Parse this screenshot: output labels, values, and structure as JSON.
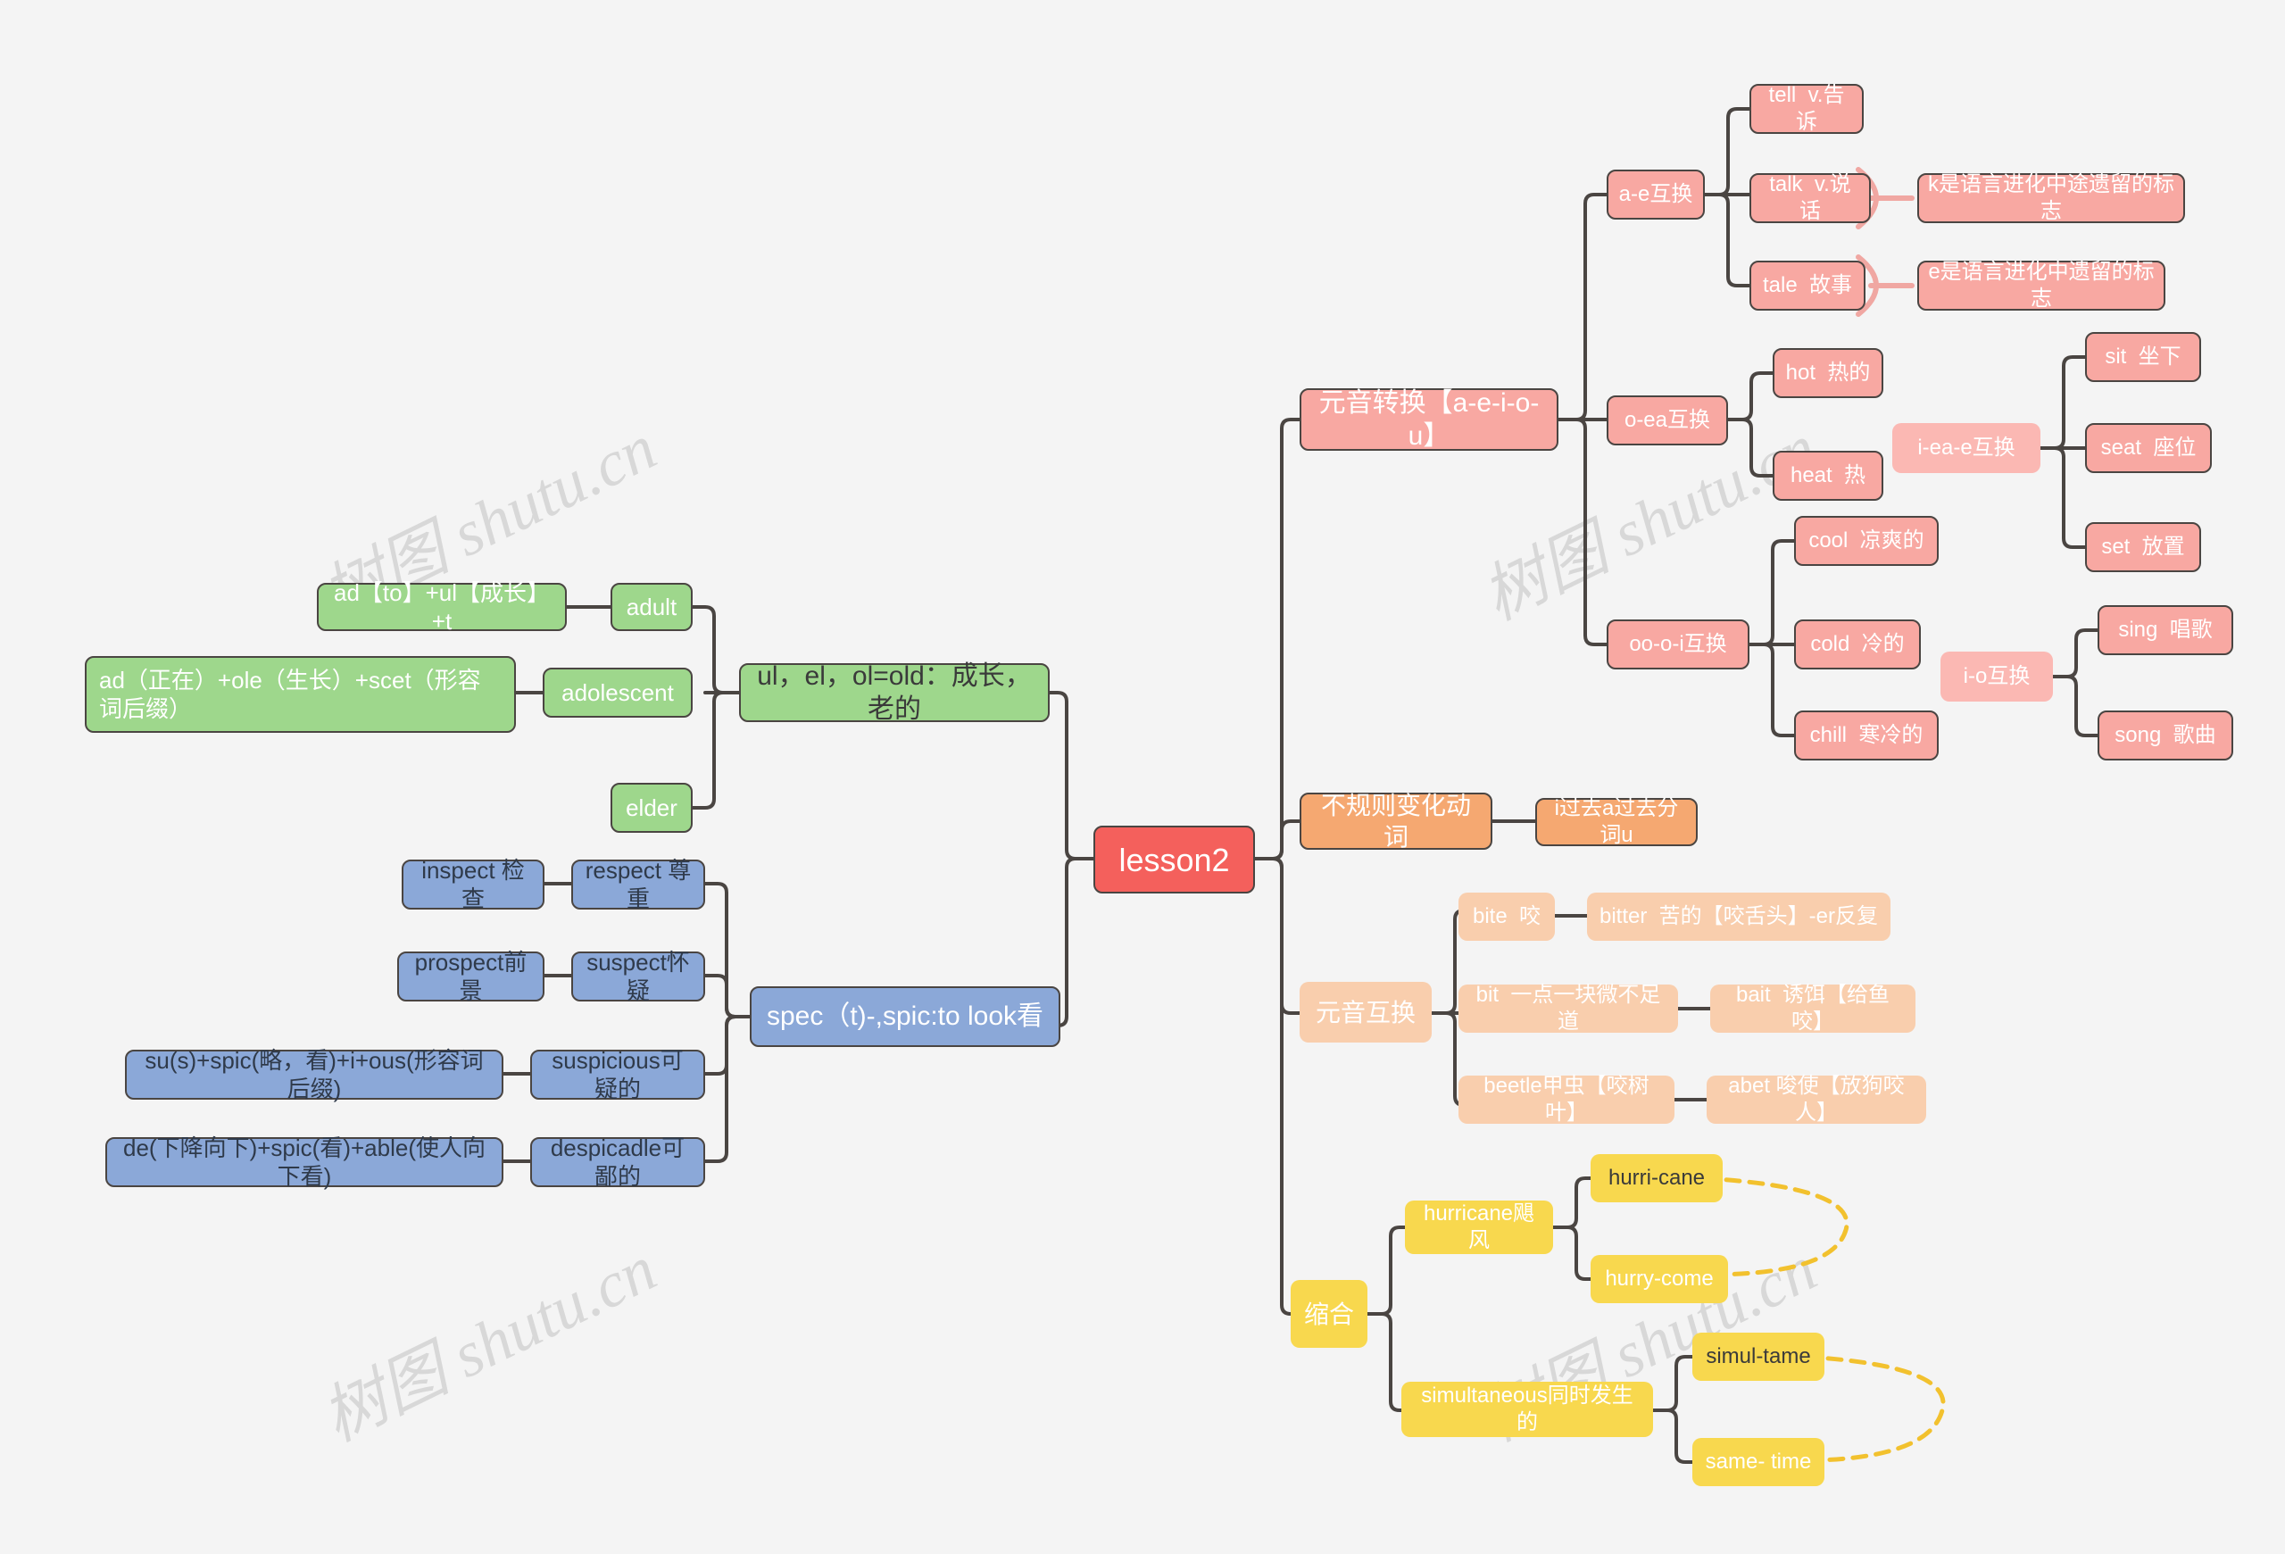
{
  "colors": {
    "background": "#f4f4f4",
    "root": "#f4605c",
    "green": "#9ed78c",
    "blue": "#8ba8d8",
    "pink": "#f8a8a2",
    "pink_light": "#fbb8b3",
    "orange": "#f5a871",
    "orange_light": "#f9cead",
    "yellow": "#f8d84e",
    "edge_dark": "#4a4542",
    "edge_pink": "#f0a7a2",
    "edge_yellow": "#f2c12e",
    "node_border": "#4a4542"
  },
  "watermark": {
    "text": "树图 shutu.cn",
    "color": "#d8d8d8"
  },
  "root": {
    "label": "lesson2"
  },
  "branches": {
    "ul_el_ol": {
      "label": "ul，el，ol=old：成长，老的",
      "children": [
        {
          "label": "adult",
          "source": "ad【to】+ul【成长】+t"
        },
        {
          "label": "adolescent",
          "source": "ad（正在）+ole（生长）+scet（形容词后缀）"
        },
        {
          "label": "elder",
          "source": ""
        }
      ]
    },
    "spec": {
      "label": "spec（t)-,spic:to look看",
      "children": [
        {
          "label": "respect 尊重",
          "source": "inspect 检查"
        },
        {
          "label": "suspect怀疑",
          "source": "prospect前景"
        },
        {
          "label": "suspicious可疑的",
          "source": "su(s)+spic(略，看)+i+ous(形容词后缀)"
        },
        {
          "label": "despicadle可鄙的",
          "source": "de(下降向下)+spic(看)+able(使人向下看)"
        }
      ]
    },
    "vowel_shift": {
      "label": "元音转换【a-e-i-o-u】",
      "groups": [
        {
          "label": "a-e互换",
          "items": [
            {
              "label": "tell  v.告诉",
              "note": ""
            },
            {
              "label": "talk  v.说话",
              "note": "k是语言进化中途遗留的标志"
            },
            {
              "label": "tale  故事",
              "note": "e是语言进化中遗留的标志"
            }
          ]
        },
        {
          "label": "o-ea互换",
          "items": [
            {
              "label": "hot  热的",
              "note": ""
            },
            {
              "label": "heat  热",
              "note": ""
            }
          ]
        },
        {
          "label": "oo-o-i互换",
          "items": [
            {
              "label": "cool  凉爽的",
              "note": ""
            },
            {
              "label": "cold  冷的",
              "note": ""
            },
            {
              "label": "chill  寒冷的",
              "note": ""
            }
          ]
        }
      ],
      "floating": [
        {
          "label": "i-ea-e互换",
          "items": [
            {
              "label": "sit  坐下"
            },
            {
              "label": "seat  座位"
            },
            {
              "label": "set  放置"
            }
          ]
        },
        {
          "label": "i-o互换",
          "items": [
            {
              "label": "sing  唱歌"
            },
            {
              "label": "song  歌曲"
            }
          ]
        }
      ]
    },
    "irregular_verbs": {
      "label": "不规则变化动词",
      "children": [
        {
          "label": "i过去a过去分词u"
        }
      ]
    },
    "vowel_swap": {
      "label": "元音互换",
      "pairs": [
        {
          "left": "bite  咬",
          "right": "bitter  苦的【咬舌头】-er反复"
        },
        {
          "left": "bit  一点一块微不足道",
          "right": "bait  诱饵【给鱼咬】"
        },
        {
          "left": "beetle甲虫【咬树叶】",
          "right": "abet 唆使【放狗咬人】"
        }
      ]
    },
    "contraction": {
      "label": "缩合",
      "groups": [
        {
          "label": "hurricane飓风",
          "items": [
            {
              "label": "hurri-cane"
            },
            {
              "label": "hurry-come"
            }
          ]
        },
        {
          "label": "simultaneous同时发生的",
          "items": [
            {
              "label": "simul-tame"
            },
            {
              "label": "same- time"
            }
          ]
        }
      ]
    }
  }
}
